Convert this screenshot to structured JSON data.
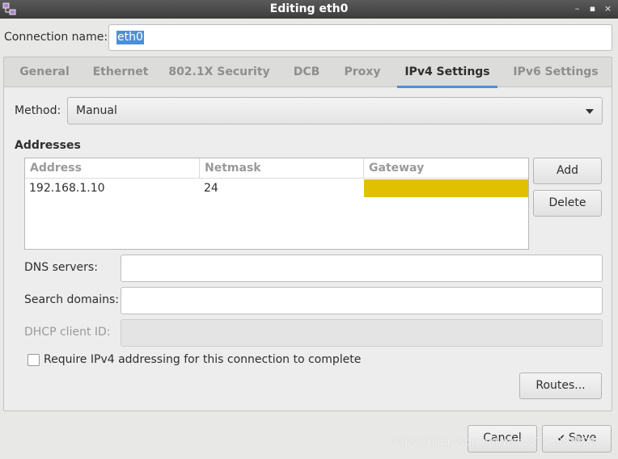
{
  "window": {
    "title": "Editing eth0",
    "controls": [
      "–",
      "▪",
      "×"
    ]
  },
  "connection": {
    "label": "Connection name:",
    "value": "eth0"
  },
  "tabs": [
    {
      "label": "General"
    },
    {
      "label": "Ethernet"
    },
    {
      "label": "802.1X Security"
    },
    {
      "label": "DCB"
    },
    {
      "label": "Proxy"
    },
    {
      "label": "IPv4 Settings",
      "active": true
    },
    {
      "label": "IPv6 Settings"
    }
  ],
  "method": {
    "label": "Method:",
    "value": "Manual"
  },
  "addresses": {
    "heading": "Addresses",
    "columns": [
      "Address",
      "Netmask",
      "Gateway"
    ],
    "rows": [
      {
        "address": "192.168.1.10",
        "netmask": "24",
        "gateway": ""
      }
    ],
    "add_label": "Add",
    "delete_label": "Delete"
  },
  "dns": {
    "label": "DNS servers:",
    "value": ""
  },
  "search_domains": {
    "label": "Search domains:",
    "value": ""
  },
  "dhcp_client_id": {
    "label": "DHCP client ID:",
    "value": "",
    "disabled": true
  },
  "require_ipv4": {
    "label": "Require IPv4 addressing for this connection to complete",
    "checked": false
  },
  "routes_label": "Routes...",
  "footer": {
    "cancel_label": "Cancel",
    "save_label": "Save"
  },
  "watermark": "https://blog.csdn.net/wzc18743083828",
  "colors": {
    "accent": "#4a90d9",
    "gateway_highlight": "#e0c000",
    "titlebar": "#3c3c3c"
  }
}
